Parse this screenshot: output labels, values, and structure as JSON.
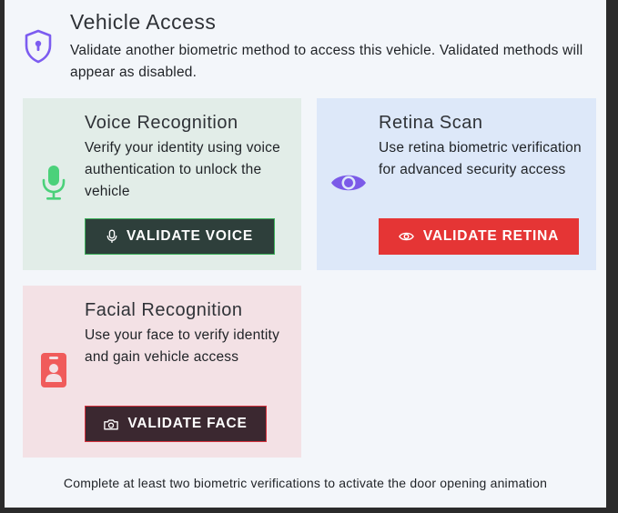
{
  "header": {
    "title": "Vehicle Access",
    "subtitle": "Validate another biometric method to access this vehicle. Validated methods will appear as disabled.",
    "icon": "shield-lock-icon"
  },
  "cards": [
    {
      "title": "Voice Recognition",
      "description": "Verify your identity using voice authentication to unlock the vehicle",
      "icon": "microphone-icon",
      "button_label": "VALIDATE VOICE",
      "button_icon": "microphone-icon",
      "accent": "#3cb05a"
    },
    {
      "title": "Retina Scan",
      "description": "Use retina biometric verification for advanced security access",
      "icon": "eye-icon",
      "button_label": "VALIDATE RETINA",
      "button_icon": "eye-icon",
      "accent": "#7a5ae6"
    },
    {
      "title": "Facial Recognition",
      "description": "Use your face to verify identity and gain vehicle access",
      "icon": "id-badge-icon",
      "button_label": "VALIDATE FACE",
      "button_icon": "camera-icon",
      "accent": "#f05b5b"
    }
  ],
  "footer": "Complete at least two biometric verifications to activate the door opening animation"
}
